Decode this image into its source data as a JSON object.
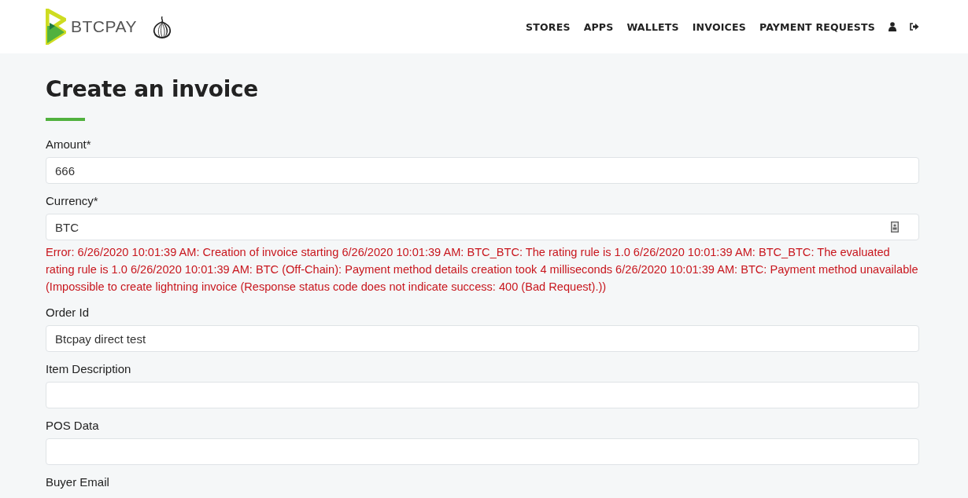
{
  "header": {
    "brand": "BTCPAY",
    "nav": [
      {
        "label": "STORES"
      },
      {
        "label": "APPS"
      },
      {
        "label": "WALLETS"
      },
      {
        "label": "INVOICES"
      },
      {
        "label": "PAYMENT REQUESTS"
      }
    ]
  },
  "page": {
    "title": "Create an invoice"
  },
  "fields": [
    {
      "kind": "text",
      "label": "Amount*",
      "value": "666"
    },
    {
      "kind": "picker",
      "label": "Currency*",
      "value": "BTC",
      "error": "Error: 6/26/2020 10:01:39 AM: Creation of invoice starting 6/26/2020 10:01:39 AM: BTC_BTC: The rating rule is 1.0 6/26/2020 10:01:39 AM: BTC_BTC: The evaluated rating rule is 1.0 6/26/2020 10:01:39 AM: BTC (Off-Chain): Payment method details creation took 4 milliseconds 6/26/2020 10:01:39 AM: BTC: Payment method unavailable (Impossible to create lightning invoice (Response status code does not indicate success: 400 (Bad Request).))"
    },
    {
      "kind": "text",
      "label": "Order Id",
      "value": "Btcpay direct test"
    },
    {
      "kind": "text",
      "label": "Item Description"
    },
    {
      "kind": "text",
      "label": "POS Data"
    },
    {
      "kind": "label",
      "label": "Buyer Email"
    }
  ]
}
